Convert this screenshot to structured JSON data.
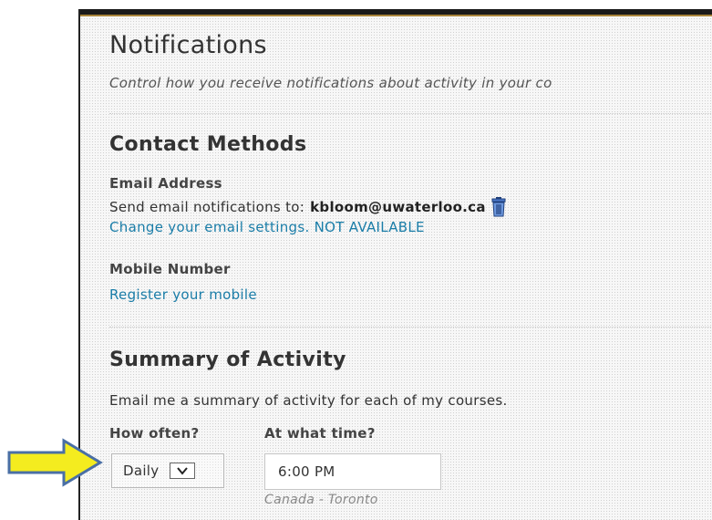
{
  "page": {
    "title": "Notifications",
    "description": "Control how you receive notifications about activity in your co"
  },
  "contact_methods": {
    "heading": "Contact Methods",
    "email": {
      "label": "Email Address",
      "send_prefix": "Send email notifications to:",
      "address": "kbloom@uwaterloo.ca",
      "delete_icon": "trash-icon",
      "change_link": "Change your email settings. NOT AVAILABLE"
    },
    "mobile": {
      "label": "Mobile Number",
      "register_link": "Register your mobile"
    }
  },
  "summary": {
    "heading": "Summary of Activity",
    "description": "Email me a summary of activity for each of my courses.",
    "frequency": {
      "label": "How often?",
      "value": "Daily",
      "dropdown_icon": "chevron-down-icon"
    },
    "time": {
      "label": "At what time?",
      "value": "6:00 PM",
      "timezone": "Canada - Toronto"
    }
  },
  "annotation": {
    "pointer_icon": "arrow-right-icon",
    "pointer_color": "#f4ec1f",
    "pointer_outline": "#4a6fa5"
  },
  "colors": {
    "link": "#1a7da8",
    "top_bar": "#1a1a1a",
    "top_bar_accent": "#a8843a"
  }
}
